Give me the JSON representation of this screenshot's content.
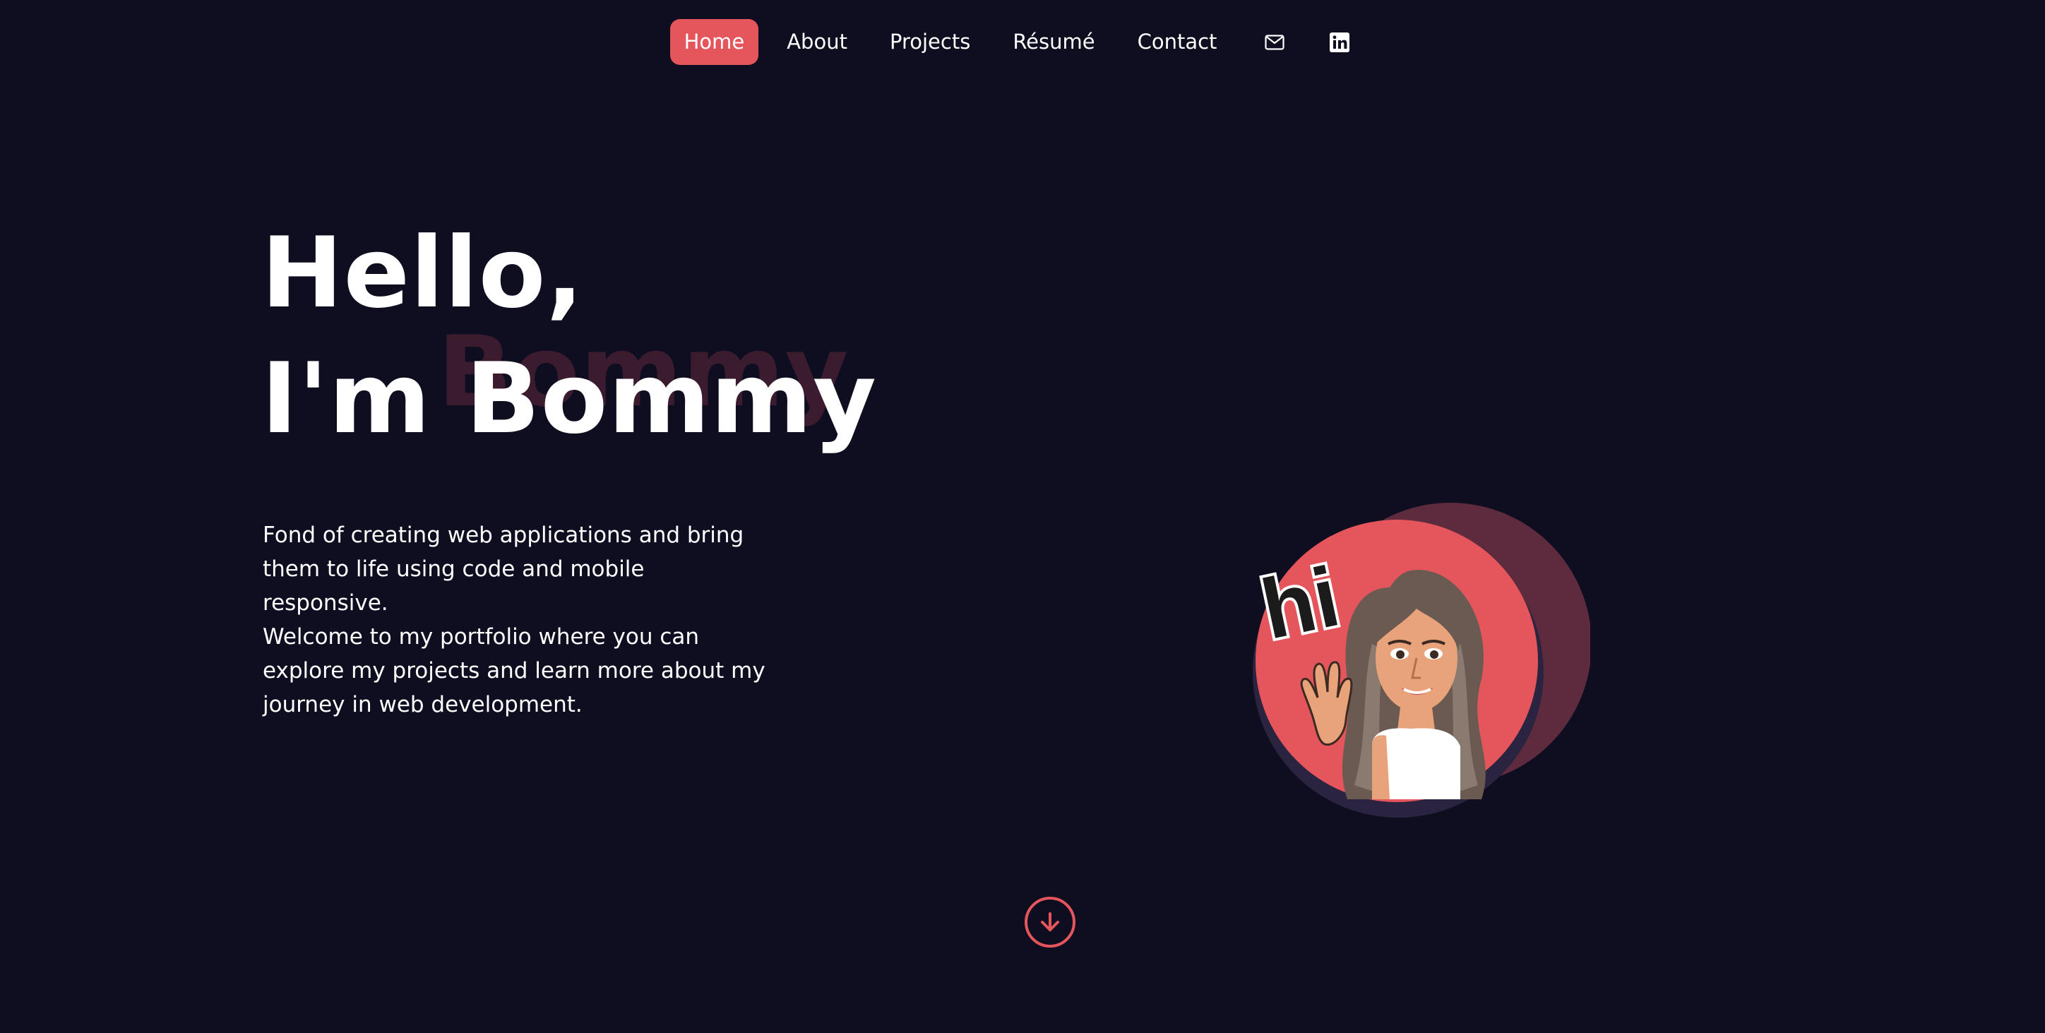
{
  "nav": {
    "items": [
      {
        "label": "Home",
        "active": true
      },
      {
        "label": "About",
        "active": false
      },
      {
        "label": "Projects",
        "active": false
      },
      {
        "label": "Résumé",
        "active": false
      },
      {
        "label": "Contact",
        "active": false
      }
    ],
    "icons": [
      "mail-icon",
      "linkedin-icon"
    ]
  },
  "hero": {
    "line1": "Hello,",
    "line2": "I'm Bommy",
    "ghost": "Bommy",
    "description1": "Fond of creating web applications and bring them to life using code and mobile responsive.",
    "description2": "Welcome to my portfolio where you can explore my projects and learn more about my journey in web development."
  },
  "avatar": {
    "greeting": "hi"
  },
  "colors": {
    "background": "#0f0e21",
    "accent": "#e5565c",
    "ghost": "#3b1c2e",
    "circle_back": "#5e2a3d"
  },
  "scroll": {
    "icon": "arrow-down-circle-icon"
  }
}
